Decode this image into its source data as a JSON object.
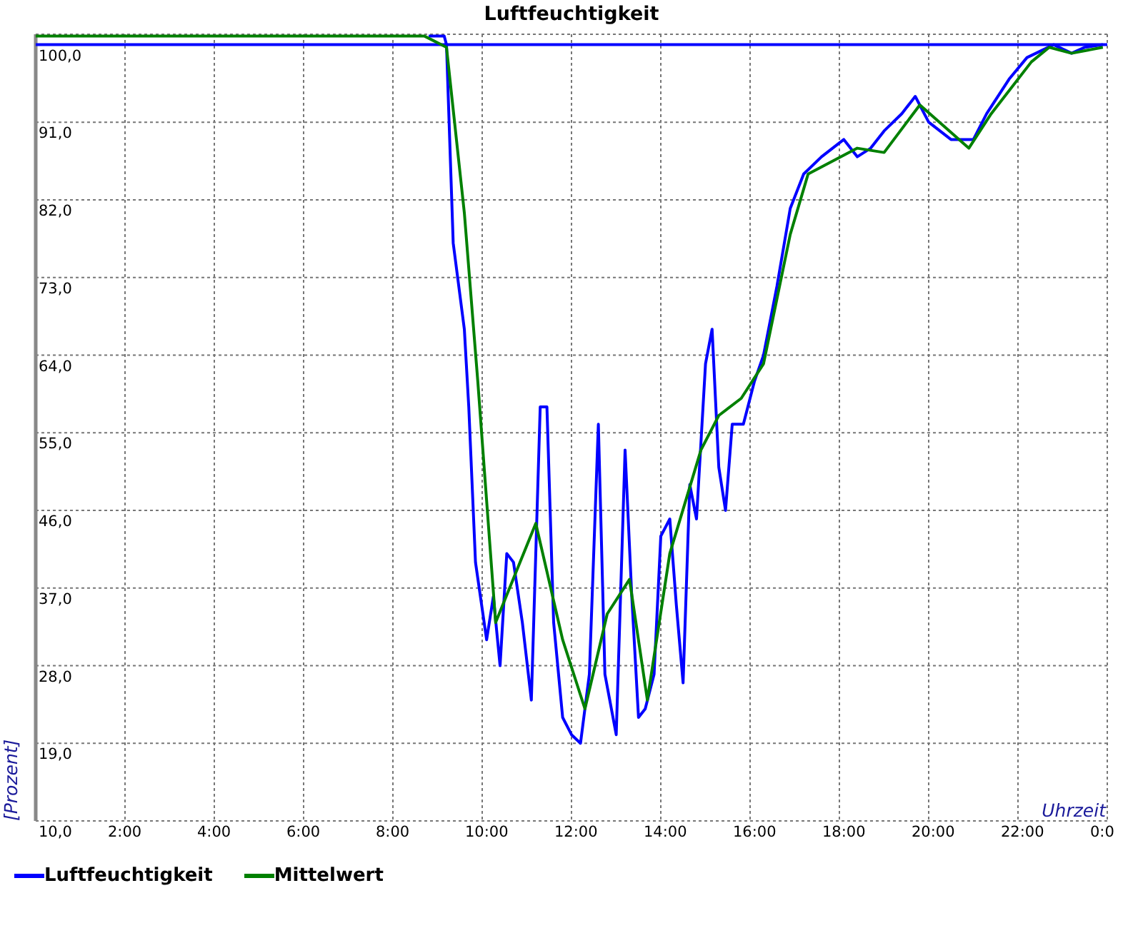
{
  "chart_data": {
    "type": "line",
    "title": "Luftfeuchtigkeit",
    "xlabel": "Uhrzeit",
    "ylabel": "[Prozent]",
    "xlim": [
      0,
      24
    ],
    "ylim": [
      10,
      101.2
    ],
    "xticks": [
      {
        "value": 2,
        "label": "2:00"
      },
      {
        "value": 4,
        "label": "4:00"
      },
      {
        "value": 6,
        "label": "6:00"
      },
      {
        "value": 8,
        "label": "8:00"
      },
      {
        "value": 10,
        "label": "10:00"
      },
      {
        "value": 12,
        "label": "12:00"
      },
      {
        "value": 14,
        "label": "14:00"
      },
      {
        "value": 16,
        "label": "16:00"
      },
      {
        "value": 18,
        "label": "18:00"
      },
      {
        "value": 20,
        "label": "20:00"
      },
      {
        "value": 22,
        "label": "22:00"
      },
      {
        "value": 24,
        "label": "0:0"
      }
    ],
    "yticks": [
      {
        "value": 10,
        "label": "10,0"
      },
      {
        "value": 19,
        "label": "19,0"
      },
      {
        "value": 28,
        "label": "28,0"
      },
      {
        "value": 37,
        "label": "37,0"
      },
      {
        "value": 46,
        "label": "46,0"
      },
      {
        "value": 55,
        "label": "55,0"
      },
      {
        "value": 64,
        "label": "64,0"
      },
      {
        "value": 73,
        "label": "73,0"
      },
      {
        "value": 82,
        "label": "82,0"
      },
      {
        "value": 91,
        "label": "91,0"
      },
      {
        "value": 100,
        "label": "100,0"
      }
    ],
    "series": [
      {
        "name": "Luftfeuchtigkeit",
        "color": "#0000ff",
        "x": [
          8.8,
          9.15,
          9.2,
          9.35,
          9.6,
          9.7,
          9.85,
          10.1,
          10.25,
          10.4,
          10.55,
          10.7,
          10.9,
          11.1,
          11.3,
          11.45,
          11.6,
          11.8,
          12.0,
          12.2,
          12.4,
          12.6,
          12.75,
          13.0,
          13.2,
          13.35,
          13.5,
          13.65,
          13.85,
          14.0,
          14.2,
          14.35,
          14.5,
          14.65,
          14.8,
          15.0,
          15.15,
          15.3,
          15.45,
          15.6,
          15.85,
          16.1,
          16.3,
          16.6,
          16.9,
          17.2,
          17.6,
          18.1,
          18.4,
          18.7,
          19.0,
          19.4,
          19.7,
          20.0,
          20.5,
          21.0,
          21.3,
          21.8,
          22.2,
          22.8,
          23.2,
          23.5,
          23.9
        ],
        "values": [
          101,
          101,
          100,
          77,
          67,
          58,
          40,
          31,
          36,
          28,
          41,
          40,
          33,
          24,
          58,
          58,
          33,
          22,
          20,
          19,
          27,
          56,
          27,
          20,
          53,
          36,
          22,
          23,
          27,
          43,
          45,
          35,
          26,
          49,
          45,
          63,
          67,
          51,
          46,
          56,
          56,
          61,
          64,
          72,
          81,
          85,
          87,
          89,
          87,
          88,
          90,
          92,
          94,
          91,
          89,
          89,
          92,
          96,
          98.5,
          100,
          99,
          99.7,
          100
        ]
      },
      {
        "name": "Mittelwert",
        "color": "#008000",
        "x": [
          0,
          8.7,
          9.2,
          9.6,
          9.9,
          10.3,
          11.2,
          11.8,
          12.3,
          12.8,
          13.3,
          13.7,
          14.2,
          14.9,
          15.3,
          15.8,
          16.3,
          16.9,
          17.3,
          18.4,
          19.0,
          19.8,
          20.9,
          21.4,
          22.3,
          22.7,
          23.2,
          23.9
        ],
        "values": [
          101,
          101,
          99.7,
          80.5,
          61,
          33,
          44.5,
          31,
          23,
          34,
          38,
          24,
          41,
          53,
          57,
          59,
          63,
          78,
          85,
          88,
          87.5,
          93,
          88,
          92,
          98,
          99.7,
          99,
          99.7
        ]
      }
    ],
    "grid": true,
    "ref_lines": [
      {
        "axis": "y",
        "value": 100,
        "color": "#0000ff"
      }
    ]
  }
}
